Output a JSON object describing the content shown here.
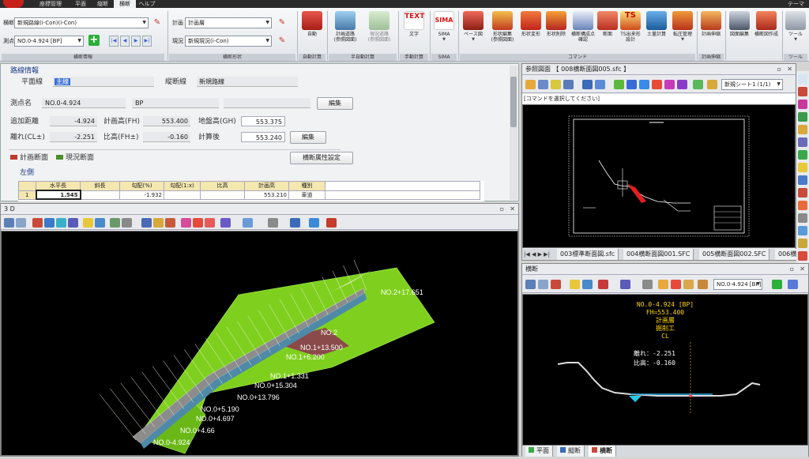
{
  "app": {
    "menu_tabs": [
      "座標管理",
      "平面",
      "縦断",
      "横断",
      "ヘルプ"
    ],
    "active_tab": "横断",
    "theme_label": "テーマ"
  },
  "ribbon": {
    "route_label": "横断",
    "route_value": "新規路線(i-Con)(i-Con)",
    "station_label": "測点",
    "station_value": "NO.0-4.924 [BP]",
    "plan_label": "計画",
    "plan_value": "計画層",
    "current_label": "現況",
    "current_value": "新規現況(i-Con)",
    "group_labels": [
      "横断情報",
      "横断形状",
      "自動計算",
      "半自動計算",
      "手動計算",
      "SIMA",
      "コマンド",
      "計画伸縮",
      "ツール"
    ],
    "tools": [
      {
        "label": "自動",
        "icon": "auto-icon"
      },
      {
        "label": "計画道路\n(参照図面)",
        "icon": "plan-road-icon"
      },
      {
        "label": "現況道路\n(参照図面)",
        "icon": "current-road-icon"
      },
      {
        "label": "文字",
        "icon": "text-icon",
        "badge": "TEXT"
      },
      {
        "label": "SIMA",
        "icon": "sima-icon",
        "badge": "SIMA"
      },
      {
        "label": "ベース図",
        "icon": "base-drawing-icon"
      },
      {
        "label": "形状編集\n(参照図面)",
        "icon": "shape-edit-icon"
      },
      {
        "label": "形状変形",
        "icon": "shape-transform-icon"
      },
      {
        "label": "形状削除",
        "icon": "shape-delete-icon"
      },
      {
        "label": "横断構成点\n確認",
        "icon": "cross-point-check-icon"
      },
      {
        "label": "断面",
        "icon": "section-icon"
      },
      {
        "label": "TS出来形\n設計",
        "icon": "ts-design-icon",
        "badge": "TS"
      },
      {
        "label": "土量計算",
        "icon": "earthwork-icon"
      },
      {
        "label": "転圧管理",
        "icon": "compaction-icon"
      },
      {
        "label": "計画伸縮",
        "icon": "plan-stretch-icon"
      },
      {
        "label": "図面編集",
        "icon": "drawing-edit-icon"
      },
      {
        "label": "横断図作成",
        "icon": "cross-drawing-icon"
      },
      {
        "label": "ツール",
        "icon": "tool-icon"
      }
    ]
  },
  "info": {
    "section_title": "路線情報",
    "plan_line_label": "平面線",
    "plan_line_value": "主線",
    "profile_line_label": "縦断線",
    "profile_line_value": "新規路線",
    "station_name_label": "測点名",
    "station_name_value": "NO.0-4.924",
    "station_bp": "BP",
    "edit_label": "編集",
    "add_dist_label": "追加距離",
    "add_dist_value": "-4.924",
    "plan_height_label": "計画高(FH)",
    "plan_height_value": "553.400",
    "ground_height_label": "地盤高(GH)",
    "ground_height_value": "553.375",
    "offset_label": "離れ(CL±)",
    "offset_value": "-2.251",
    "rel_height_label": "比高(FH±)",
    "rel_height_value": "-0.160",
    "calc_after_label": "計算後",
    "calc_after_value": "553.240",
    "edit2_label": "編集",
    "plan_section_tab": "計画断面",
    "current_section_tab": "現況断面",
    "attr_button": "横断属性設定",
    "side_label": "左側",
    "grid_headers": [
      "",
      "水平長",
      "斜長",
      "勾配(%)",
      "勾配(1:x)",
      "比高",
      "計画高",
      "種別"
    ],
    "grid_rows": [
      [
        "1",
        "1.545",
        "",
        "-1.932",
        "",
        "",
        "553.210",
        "車道"
      ]
    ]
  },
  "pane3d": {
    "title": "3 D",
    "labels": [
      "NO.2+17.651",
      "NO.2",
      "NO.1+13.500",
      "NO.1+6.200",
      "NO.1+1.331",
      "NO.0+15.304",
      "NO.0+13.796",
      "NO.0+5.190",
      "NO.0+4.697",
      "NO.0+4.66",
      "NO.0-4.924"
    ]
  },
  "ref": {
    "title": "参照図面 【 008横断面図005.sfc 】",
    "sheet_select": "新規シート1 (1/1)",
    "hint": "[コマンドを選択してください]",
    "sheet_tabs": [
      "003標準断面図.sfc",
      "004横断面図001.SFC",
      "005横断面図002.SFC",
      "006横"
    ]
  },
  "cross": {
    "title": "横断",
    "station_select": "NO.0-4.924 [BP]",
    "annot_lines": [
      "NO.0-4.924 [BP]",
      "FH=553.400",
      "計画層",
      "掘削工",
      "CL"
    ],
    "offset_line": "離れ：-2.251",
    "height_line": "比高：-0.160"
  },
  "bottom_tabs": [
    "平面",
    "縦断",
    "横断"
  ],
  "colors": {
    "accent": "#ffd700",
    "slope": "#7ccd1e",
    "pavement": "#8c8c8c",
    "sidewall": "#8b4a4a"
  }
}
